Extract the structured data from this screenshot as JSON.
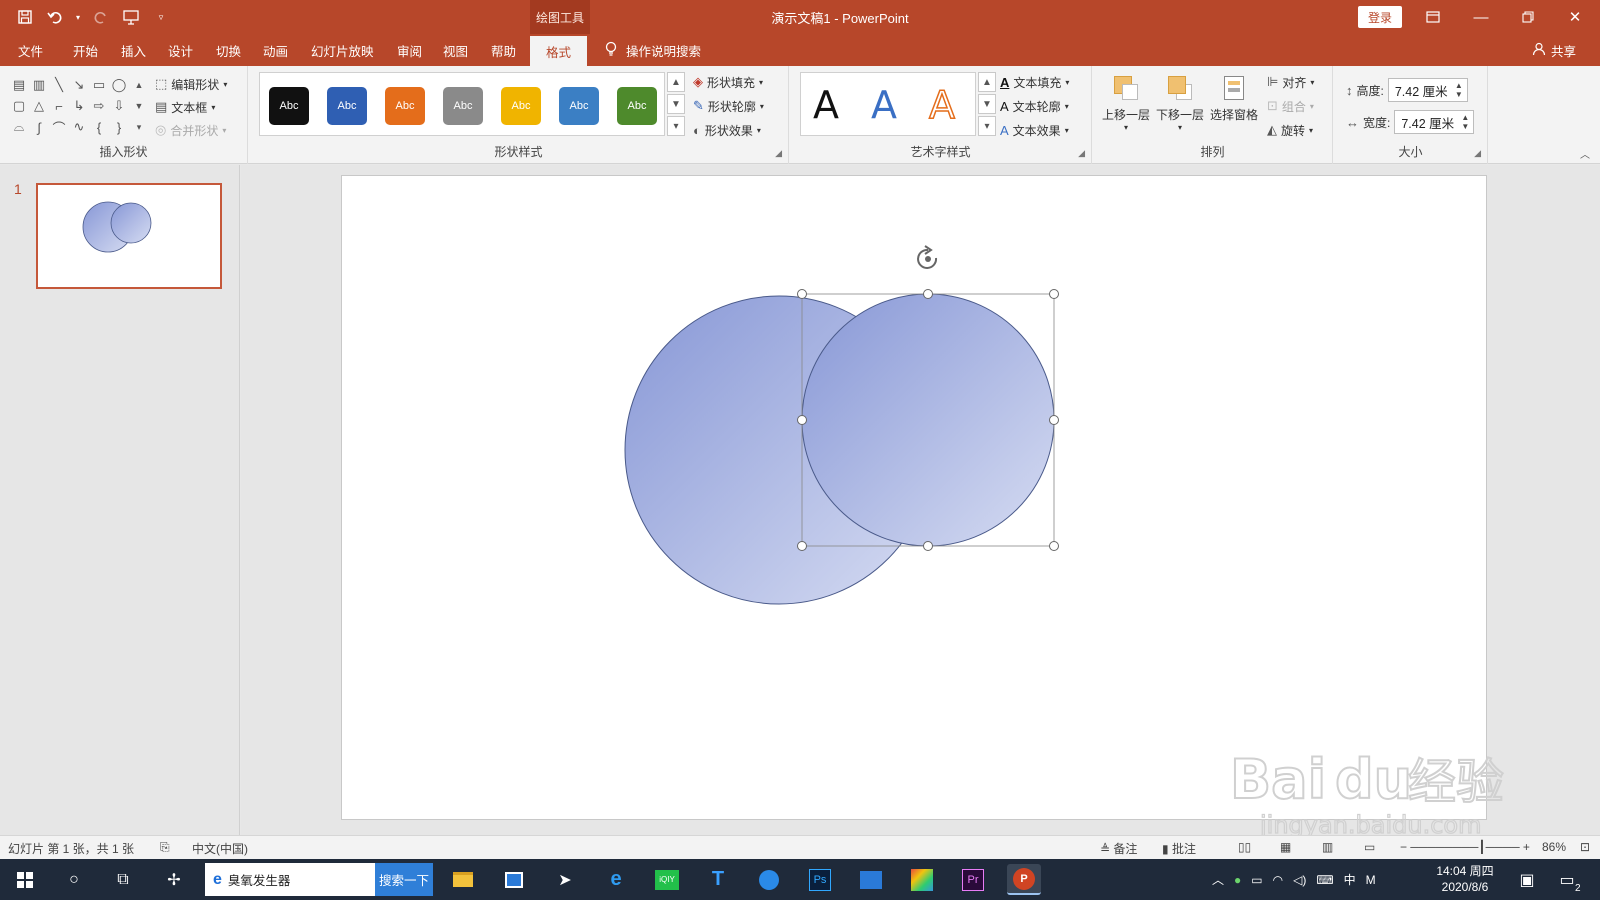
{
  "colors": {
    "brand": "#b7472a",
    "circle_fill_start": "#8797d6",
    "circle_fill_end": "#d6dcf2",
    "circle_stroke": "#4a5a8a"
  },
  "title_bar": {
    "context_tools": "绘图工具",
    "window_title": "演示文稿1  -  PowerPoint",
    "login": "登录"
  },
  "tabs": [
    {
      "label": "文件"
    },
    {
      "label": "开始"
    },
    {
      "label": "插入"
    },
    {
      "label": "设计"
    },
    {
      "label": "切换"
    },
    {
      "label": "动画"
    },
    {
      "label": "幻灯片放映"
    },
    {
      "label": "审阅"
    },
    {
      "label": "视图"
    },
    {
      "label": "帮助"
    },
    {
      "label": "格式"
    }
  ],
  "tell_me": "操作说明搜索",
  "share": "共享",
  "ribbon": {
    "insert_shapes": {
      "label": "插入形状",
      "edit_shape": "编辑形状",
      "text_box": "文本框",
      "merge_shapes": "合并形状"
    },
    "shape_styles": {
      "label": "形状样式",
      "swatches": [
        {
          "text": "Abc",
          "color": "#111111"
        },
        {
          "text": "Abc",
          "color": "#2f5fb3"
        },
        {
          "text": "Abc",
          "color": "#e46d1b"
        },
        {
          "text": "Abc",
          "color": "#8a8a8a"
        },
        {
          "text": "Abc",
          "color": "#f0b400"
        },
        {
          "text": "Abc",
          "color": "#3b7fc4"
        },
        {
          "text": "Abc",
          "color": "#4e8a2c"
        }
      ],
      "fill": "形状填充",
      "outline": "形状轮廓",
      "effects": "形状效果"
    },
    "wordart": {
      "label": "艺术字样式",
      "samples": [
        "A",
        "A",
        "A"
      ],
      "text_fill": "文本填充",
      "text_outline": "文本轮廓",
      "text_effects": "文本效果"
    },
    "arrange": {
      "label": "排列",
      "bring_forward": "上移一层",
      "send_backward": "下移一层",
      "selection_pane": "选择窗格",
      "align": "对齐",
      "group": "组合",
      "rotate": "旋转"
    },
    "size": {
      "label": "大小",
      "height_label": "高度:",
      "height_value": "7.42 厘米",
      "width_label": "宽度:",
      "width_value": "7.42 厘米"
    }
  },
  "thumbnails": [
    {
      "number": "1"
    }
  ],
  "status": {
    "slide_info": "幻灯片 第 1 张，共 1 张",
    "language": "中文(中国)",
    "notes": "备注",
    "comments": "批注",
    "zoom": "86%"
  },
  "taskbar": {
    "search_text": "臭氧发生器",
    "search_button": "搜索一下",
    "ime": "中",
    "ime2": "M",
    "time": "14:04 周四",
    "date": "2020/8/6",
    "notification_count": "2"
  },
  "watermark": {
    "brand": "Bai",
    "brand2": "du",
    "cn": "经验",
    "url": "jingyan.baidu.com"
  }
}
